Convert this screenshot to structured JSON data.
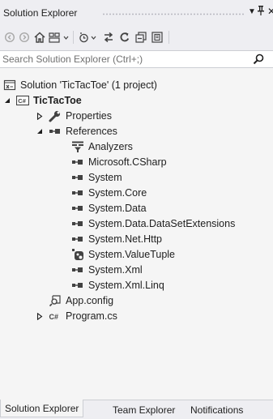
{
  "title": "Solution Explorer",
  "title_controls": {
    "dropdown": "▼",
    "pin": "🖈",
    "close": "✕"
  },
  "search": {
    "placeholder": "Search Solution Explorer (Ctrl+;)"
  },
  "tree": {
    "solution": "Solution 'TicTacToe' (1 project)",
    "project": "TicTacToe",
    "properties": "Properties",
    "references": "References",
    "reference_items": [
      "Analyzers",
      "Microsoft.CSharp",
      "System",
      "System.Core",
      "System.Data",
      "System.Data.DataSetExtensions",
      "System.Net.Http",
      "System.ValueTuple",
      "System.Xml",
      "System.Xml.Linq"
    ],
    "app_config": "App.config",
    "program": "Program.cs"
  },
  "tabs": [
    "Solution Explorer",
    "Team Explorer",
    "Notifications"
  ],
  "colors": {
    "accent": "#0e70c0",
    "reference": "#424242",
    "wrench": "#424242"
  }
}
